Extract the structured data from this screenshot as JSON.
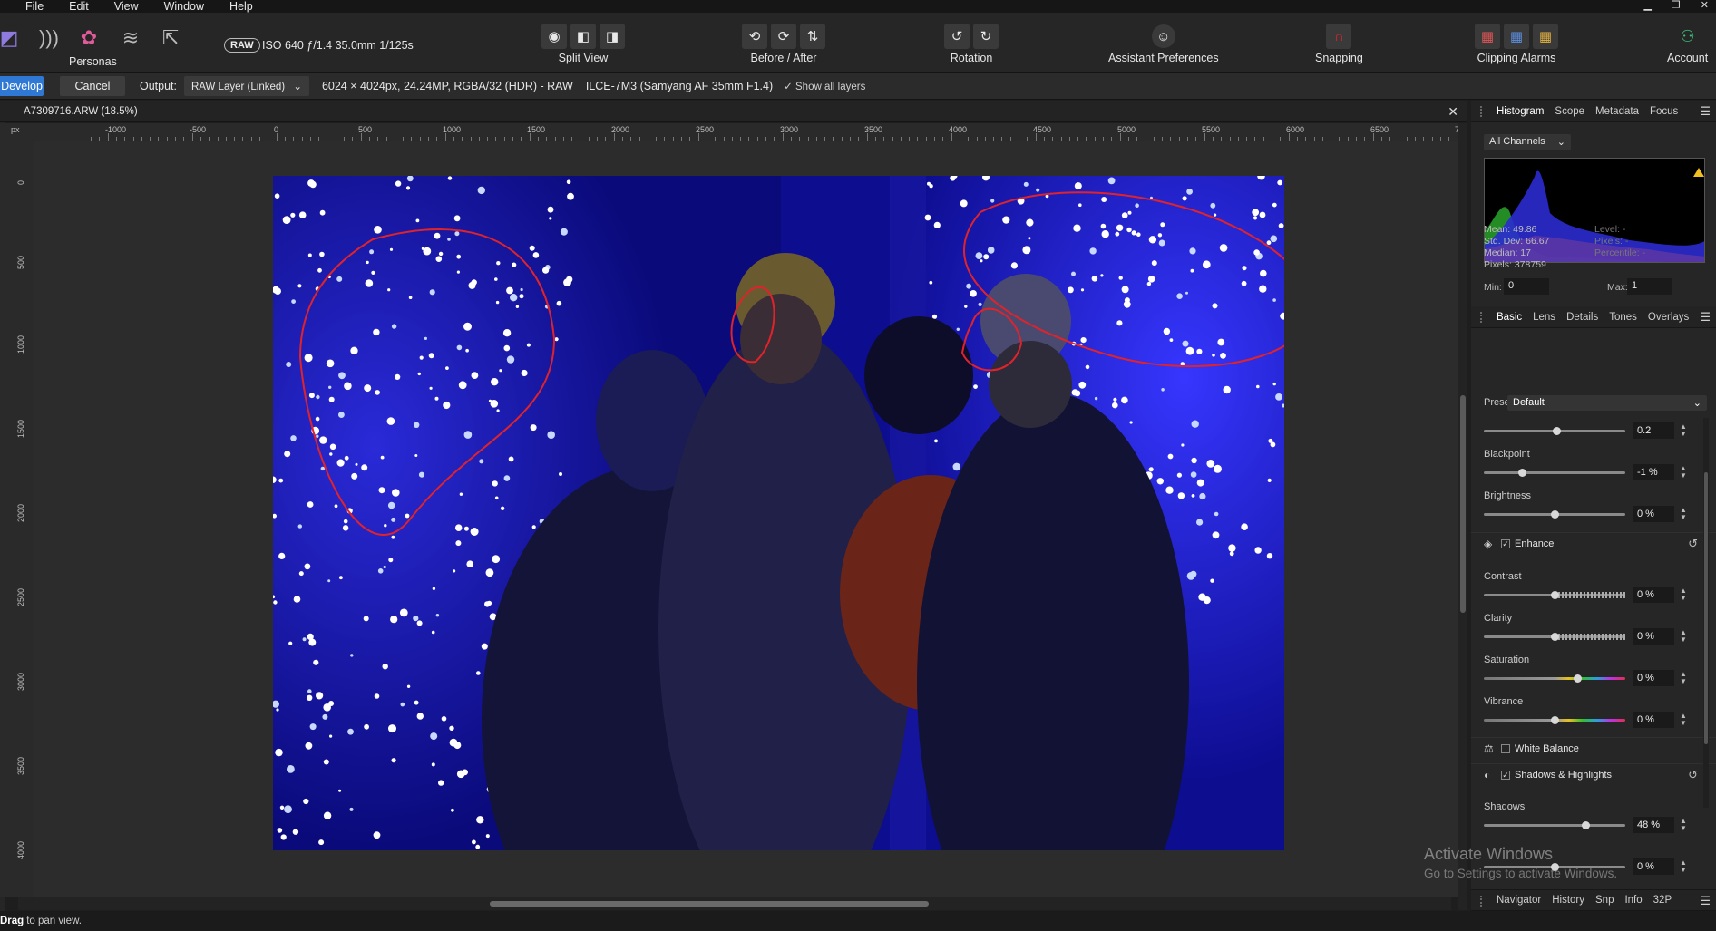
{
  "menu": [
    "File",
    "Edit",
    "View",
    "Window",
    "Help"
  ],
  "toolbar": {
    "personas_label": "Personas",
    "raw_badge": "RAW",
    "exif": "ISO 640 ƒ/1.4 35.0mm 1/125s",
    "split_view_label": "Split View",
    "before_after_label": "Before / After",
    "rotation_label": "Rotation",
    "assistant_label": "Assistant Preferences",
    "snapping_label": "Snapping",
    "clipping_label": "Clipping Alarms",
    "account_label": "Account"
  },
  "context": {
    "develop": "Develop",
    "cancel": "Cancel",
    "output_label": "Output:",
    "output_value": "RAW Layer (Linked)",
    "image_info": "6024 × 4024px, 24.24MP, RGBA/32 (HDR) - RAW",
    "camera": "ILCE-7M3 (Samyang AF 35mm F1.4)",
    "show_all_layers": "Show all layers"
  },
  "document": {
    "title": "A7309716.ARW (18.5%)",
    "ruler_unit": "px",
    "ruler_top": [
      "-1000",
      "-500",
      "0",
      "500",
      "1000",
      "1500",
      "2000",
      "2500",
      "3000",
      "3500",
      "4000",
      "4500",
      "5000",
      "5500",
      "6000",
      "6500",
      "700"
    ],
    "ruler_left": [
      "0",
      "500",
      "1000",
      "1500",
      "2000",
      "2500",
      "3000",
      "3500",
      "4000"
    ]
  },
  "status": {
    "bold": "Drag",
    "text": "to pan view."
  },
  "histogram_panel": {
    "tabs": [
      "Histogram",
      "Scope",
      "Metadata",
      "Focus"
    ],
    "channel": "All Channels",
    "mean": "Mean: 49.86",
    "std_dev": "Std. Dev: 66.67",
    "median": "Median: 17",
    "pixels": "Pixels: 378759",
    "level": "Level: -",
    "pixels_r": "Pixels: -",
    "percentile": "Percentile: -",
    "min_label": "Min:",
    "min_value": "0",
    "max_label": "Max:",
    "max_value": "1"
  },
  "adjust_panel": {
    "tabs": [
      "Basic",
      "Lens",
      "Details",
      "Tones",
      "Overlays"
    ],
    "preset_label": "Preset:",
    "preset_value": "Default",
    "exposure_value": "0.2",
    "blackpoint_label": "Blackpoint",
    "blackpoint_value": "-1 %",
    "brightness_label": "Brightness",
    "brightness_value": "0 %",
    "enhance_label": "Enhance",
    "contrast_label": "Contrast",
    "contrast_value": "0 %",
    "clarity_label": "Clarity",
    "clarity_value": "0 %",
    "saturation_label": "Saturation",
    "saturation_value": "0 %",
    "vibrance_label": "Vibrance",
    "vibrance_value": "0 %",
    "white_balance_label": "White Balance",
    "shadows_highlights_label": "Shadows & Highlights",
    "shadows_label": "Shadows",
    "shadows_value": "48 %",
    "highlights_value": "0 %"
  },
  "bottom_tabs": [
    "Navigator",
    "History",
    "Snp",
    "Info",
    "32P"
  ],
  "watermark": {
    "line1": "Activate Windows",
    "line2": "Go to Settings to activate Windows."
  },
  "colors": {
    "accent": "#2f79d4",
    "annotation": "#e0232a"
  }
}
